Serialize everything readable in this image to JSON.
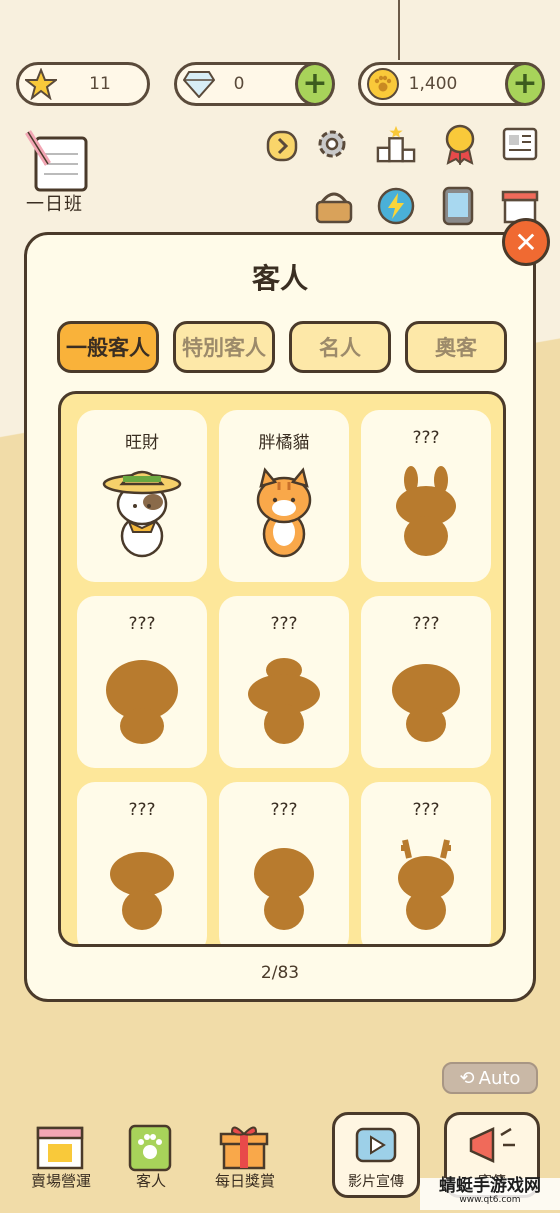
{
  "resources": {
    "stars": "11",
    "diamonds": "0",
    "coins": "1,400"
  },
  "notebook": {
    "label": "一日班"
  },
  "modal": {
    "title": "客人",
    "tabs": [
      "一般客人",
      "特別客人",
      "名人",
      "奧客"
    ],
    "active_tab": "一般客人",
    "cards": [
      {
        "name": "旺財",
        "unlocked": true
      },
      {
        "name": "胖橘貓",
        "unlocked": true
      },
      {
        "name": "???",
        "unlocked": false
      },
      {
        "name": "???",
        "unlocked": false
      },
      {
        "name": "???",
        "unlocked": false
      },
      {
        "name": "???",
        "unlocked": false
      },
      {
        "name": "???",
        "unlocked": false
      },
      {
        "name": "???",
        "unlocked": false
      },
      {
        "name": "???",
        "unlocked": false
      }
    ],
    "page_indicator": "2/83"
  },
  "auto_label": "Auto",
  "bottom_nav": {
    "items": [
      "賣場營運",
      "客人",
      "每日獎賞"
    ],
    "video_promo": "影片宣傳",
    "promo": "宣傳"
  },
  "watermark": {
    "main": "蜻蜓手游戏网",
    "url": "www.qt6.com"
  },
  "colors": {
    "accent": "#f9b23a",
    "silhouette": "#b87b2e",
    "close": "#f06a32",
    "plus": "#a8d35a"
  }
}
